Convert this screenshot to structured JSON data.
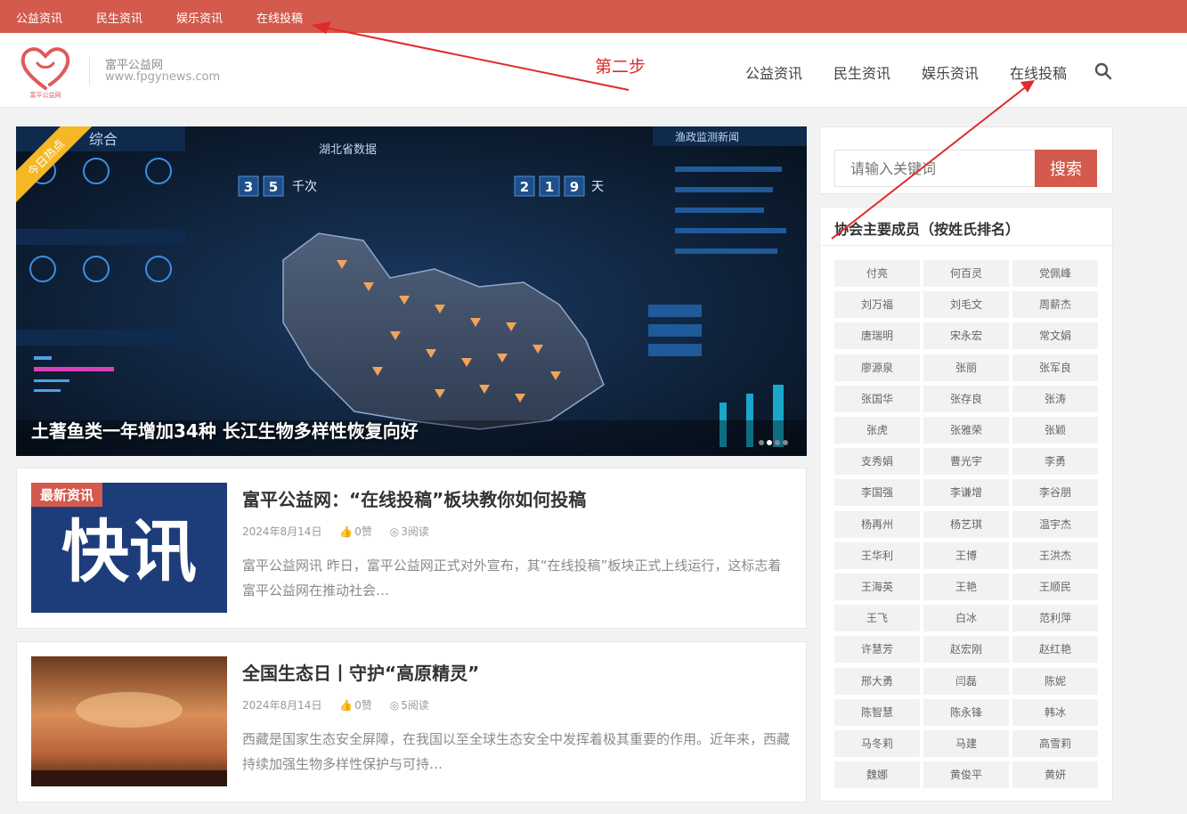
{
  "topbar": {
    "links": [
      "公益资讯",
      "民生资讯",
      "娱乐资讯",
      "在线投稿"
    ]
  },
  "header": {
    "logo_text": "富平公益网",
    "site_name": "富平公益网",
    "site_url": "www.fpgynews.com",
    "step_annotation": "第二步",
    "nav": [
      "公益资讯",
      "民生资讯",
      "娱乐资讯",
      "在线投稿"
    ]
  },
  "slider": {
    "ribbon": "今日热点",
    "caption": "土著鱼类一年增加34种 长江生物多样性恢复向好",
    "overlay_title": "湖北省数据",
    "overlay_side_title": "渔政监测新闻",
    "overlay_left_title": "综合",
    "counter_left": [
      "3",
      "5"
    ],
    "counter_left_unit": "千次",
    "counter_right": [
      "2",
      "1",
      "9"
    ],
    "counter_right_unit": "天",
    "active_dot": 1
  },
  "articles": [
    {
      "tag": "最新资讯",
      "thumb_text": "快讯",
      "title": "富平公益网：“在线投稿”板块教你如何投稿",
      "date": "2024年8月14日",
      "likes": "0赞",
      "reads": "3阅读",
      "excerpt": "富平公益网讯 昨日，富平公益网正式对外宣布，其“在线投稿”板块正式上线运行，这标志着富平公益网在推动社会…"
    },
    {
      "tag": "",
      "thumb_text": "",
      "title": "全国生态日丨守护“高原精灵”",
      "date": "2024年8月14日",
      "likes": "0赞",
      "reads": "5阅读",
      "excerpt": "西藏是国家生态安全屏障，在我国以至全球生态安全中发挥着极其重要的作用。近年来，西藏持续加强生物多样性保护与可持…"
    }
  ],
  "search": {
    "placeholder": "请输入关键词",
    "button": "搜索"
  },
  "members": {
    "title": "协会主要成员（按姓氏排名）",
    "names": [
      "付亮",
      "何百灵",
      "党佩峰",
      "刘万福",
      "刘毛文",
      "周薪杰",
      "唐瑞明",
      "宋永宏",
      "常文娟",
      "廖源泉",
      "张丽",
      "张军良",
      "张国华",
      "张存良",
      "张涛",
      "张虎",
      "张雅荣",
      "张颖",
      "支秀娟",
      "曹光宇",
      "李勇",
      "李国强",
      "李谦增",
      "李谷朋",
      "杨再州",
      "杨艺琪",
      "温宇杰",
      "王华利",
      "王博",
      "王洪杰",
      "王海英",
      "王艳",
      "王顺民",
      "王飞",
      "白冰",
      "范利萍",
      "许慧芳",
      "赵宏刚",
      "赵红艳",
      "邢大勇",
      "闫磊",
      "陈妮",
      "陈智慧",
      "陈永锋",
      "韩冰",
      "马冬莉",
      "马建",
      "高雪莉",
      "魏娜",
      "黄俊平",
      "黄妍"
    ]
  },
  "colors": {
    "brand": "#d35a4c",
    "annotation": "#e02b2b",
    "ribbon": "#f4b824"
  }
}
